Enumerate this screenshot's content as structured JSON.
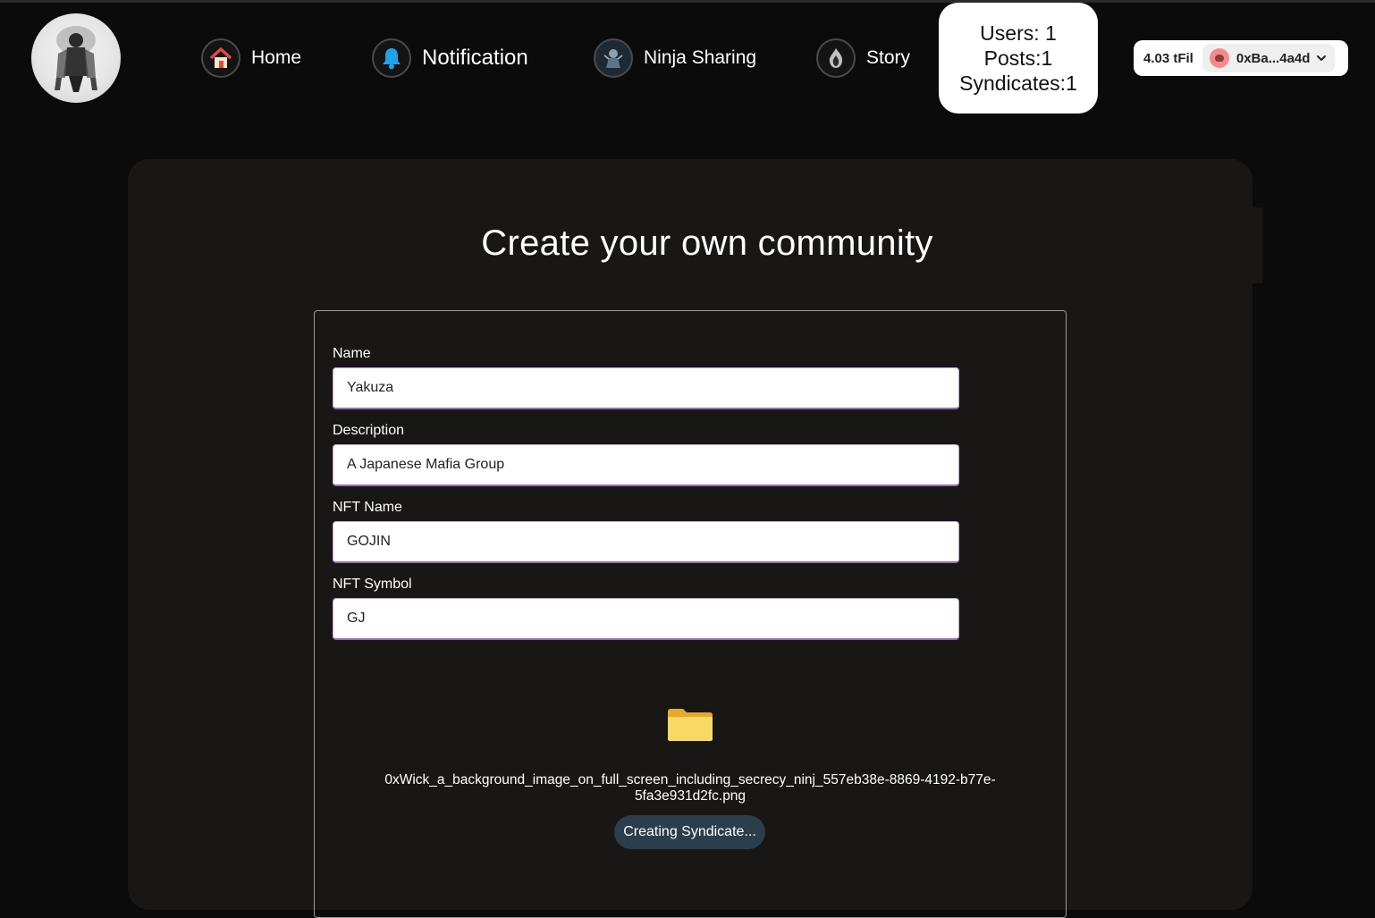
{
  "nav": {
    "home_label": "Home",
    "notification_label": "Notification",
    "ninja_sharing_label": "Ninja Sharing",
    "story_label": "Story"
  },
  "stats": {
    "users": "Users: 1",
    "posts": "Posts:1",
    "syndicates": "Syndicates:1"
  },
  "wallet": {
    "balance": "4.03 tFil",
    "account": "0xBa...4a4d"
  },
  "page": {
    "title": "Create your own community"
  },
  "form": {
    "name_label": "Name",
    "name_value": "Yakuza",
    "description_label": "Description",
    "description_value": "A Japanese Mafia Group",
    "nft_name_label": "NFT Name",
    "nft_name_value": "GOJIN",
    "nft_symbol_label": "NFT Symbol",
    "nft_symbol_value": "GJ",
    "file_name_line1": "0xWick_a_background_image_on_full_screen_including_secrecy_ninj_557eb38e-8869-4192-b77e-",
    "file_name_line2": "5fa3e931d2fc.png",
    "submit_label": "Creating Syndicate..."
  },
  "icons": {
    "logo": "ninja-logo-icon",
    "home": "house-icon",
    "notification": "bell-icon",
    "ninja_sharing": "ninja-avatar-icon",
    "story": "flame-icon",
    "upload": "folder-icon",
    "account_avatar": "avatar-icon",
    "dropdown": "chevron-down-icon"
  },
  "colors": {
    "background": "#0b0b0b",
    "panel": "#181716",
    "button": "#2c3e4b",
    "input_border": "#9b6bb5",
    "bell": "#1fa2e6",
    "folder": "#f7c948"
  }
}
